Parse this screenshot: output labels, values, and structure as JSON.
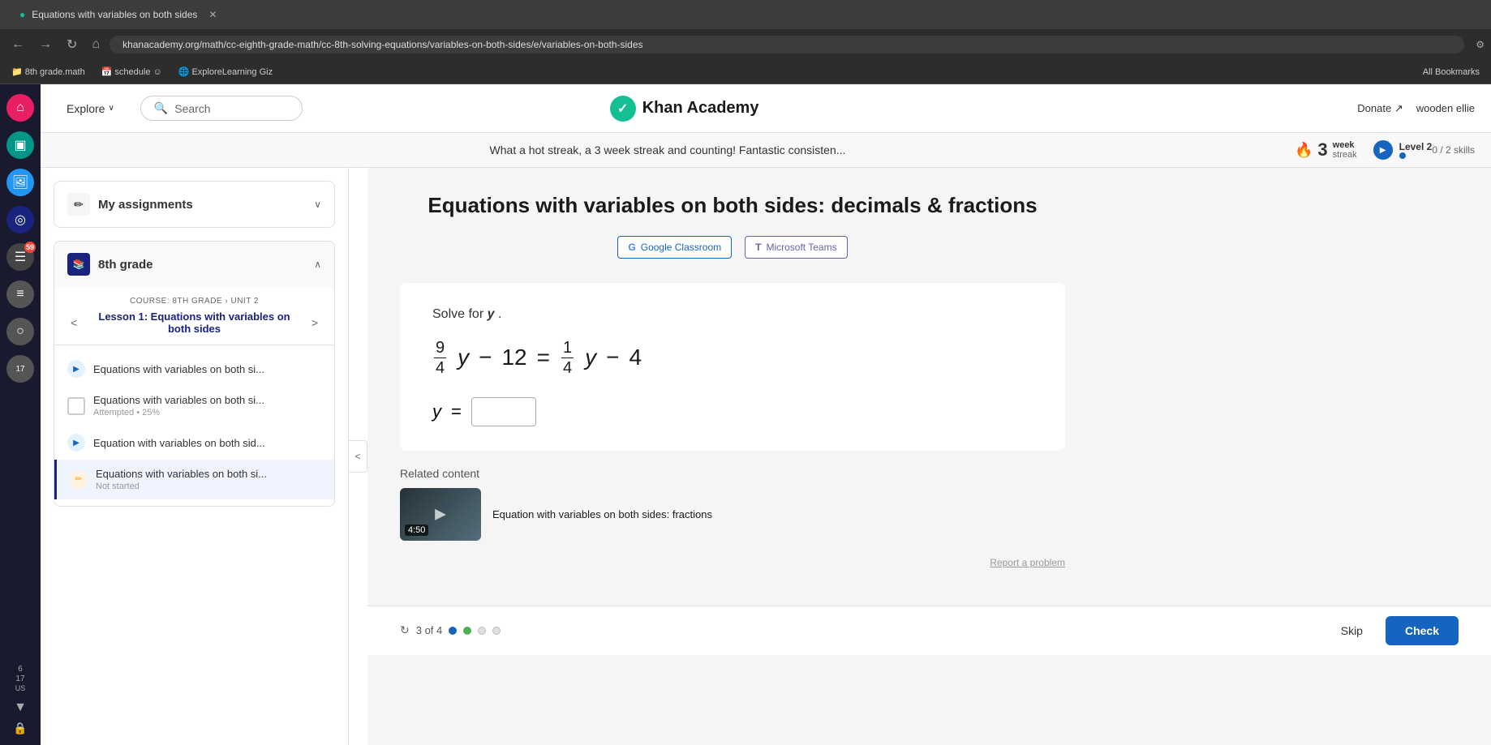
{
  "browser": {
    "url": "khanacademy.org/math/cc-eighth-grade-math/cc-8th-solving-equations/variables-on-both-sides/e/variables-on-both-sides",
    "tab_title": "Equations with variables on both sides",
    "bookmarks": [
      "8th grade.math",
      "schedule ☺",
      "ExploreLearning Giz",
      "All Bookmarks"
    ]
  },
  "header": {
    "explore": "Explore",
    "search_placeholder": "Search",
    "logo_text": "Khan Academy",
    "donate_label": "Donate",
    "username": "wooden ellie",
    "external_icon": "↗"
  },
  "streak_bar": {
    "message": "What a hot streak, a 3 week streak and counting! Fantastic consisten...",
    "streak_count": "3",
    "streak_unit": "week",
    "streak_label": "streak",
    "level_label": "Level 2",
    "skills_label": "0 / 2 skills"
  },
  "sidebar_icons": [
    {
      "name": "home",
      "symbol": "⌂",
      "style": "pink"
    },
    {
      "name": "tv",
      "symbol": "▣",
      "style": "teal"
    },
    {
      "name": "image",
      "symbol": "🖼",
      "style": "dark"
    },
    {
      "name": "camera",
      "symbol": "⬡",
      "style": "dark-blue"
    },
    {
      "name": "gallery",
      "symbol": "□",
      "style": "dark"
    },
    {
      "name": "music",
      "symbol": "≡",
      "style": "dark"
    },
    {
      "name": "circle",
      "symbol": "○",
      "style": "dark"
    },
    {
      "name": "calendar",
      "symbol": "17",
      "style": "dark"
    }
  ],
  "course_nav": {
    "assignments_label": "My assignments",
    "course_label": "8th grade",
    "breadcrumb": "COURSE: 8TH GRADE › UNIT 2",
    "lesson_title": "Lesson 1: Equations with variables on both sides",
    "exercises": [
      {
        "type": "play",
        "title": "Equations with variables on both si...",
        "subtitle": ""
      },
      {
        "type": "checkbox",
        "title": "Equations with variables on both si...",
        "subtitle": "Attempted • 25%"
      },
      {
        "type": "play",
        "title": "Equation with variables on both sid...",
        "subtitle": ""
      },
      {
        "type": "edit",
        "title": "Equations with variables on both si...",
        "subtitle": "Not started",
        "active": true
      }
    ]
  },
  "problem": {
    "title": "Equations with variables on both sides: decimals & fractions",
    "google_classroom": "Google Classroom",
    "microsoft_teams": "Microsoft Teams",
    "solve_for_prefix": "Solve for ",
    "solve_var": "y",
    "solve_for_suffix": ".",
    "equation_display": "9/4 y − 12 = 1/4 y − 4",
    "num1": "9",
    "den1": "4",
    "var1": "y",
    "op1": "−",
    "const1": "12",
    "eq_sign": "=",
    "num2": "1",
    "den2": "4",
    "var2": "y",
    "op2": "−",
    "const2": "4",
    "answer_prefix": "y =",
    "answer_value": ""
  },
  "related": {
    "section_label": "Related content",
    "video_title": "Equation with variables on both sides: fractions",
    "video_duration": "4:50"
  },
  "bottom": {
    "progress_text": "3 of 4",
    "skip_label": "Skip",
    "check_label": "Check"
  },
  "icons": {
    "search": "🔍",
    "chevron_down": "∨",
    "chevron_up": "∧",
    "chevron_left": "<",
    "chevron_right": ">",
    "collapse": "<",
    "play": "▶",
    "refresh": "↻",
    "google_icon": "G",
    "teams_icon": "T",
    "external": "↗"
  }
}
